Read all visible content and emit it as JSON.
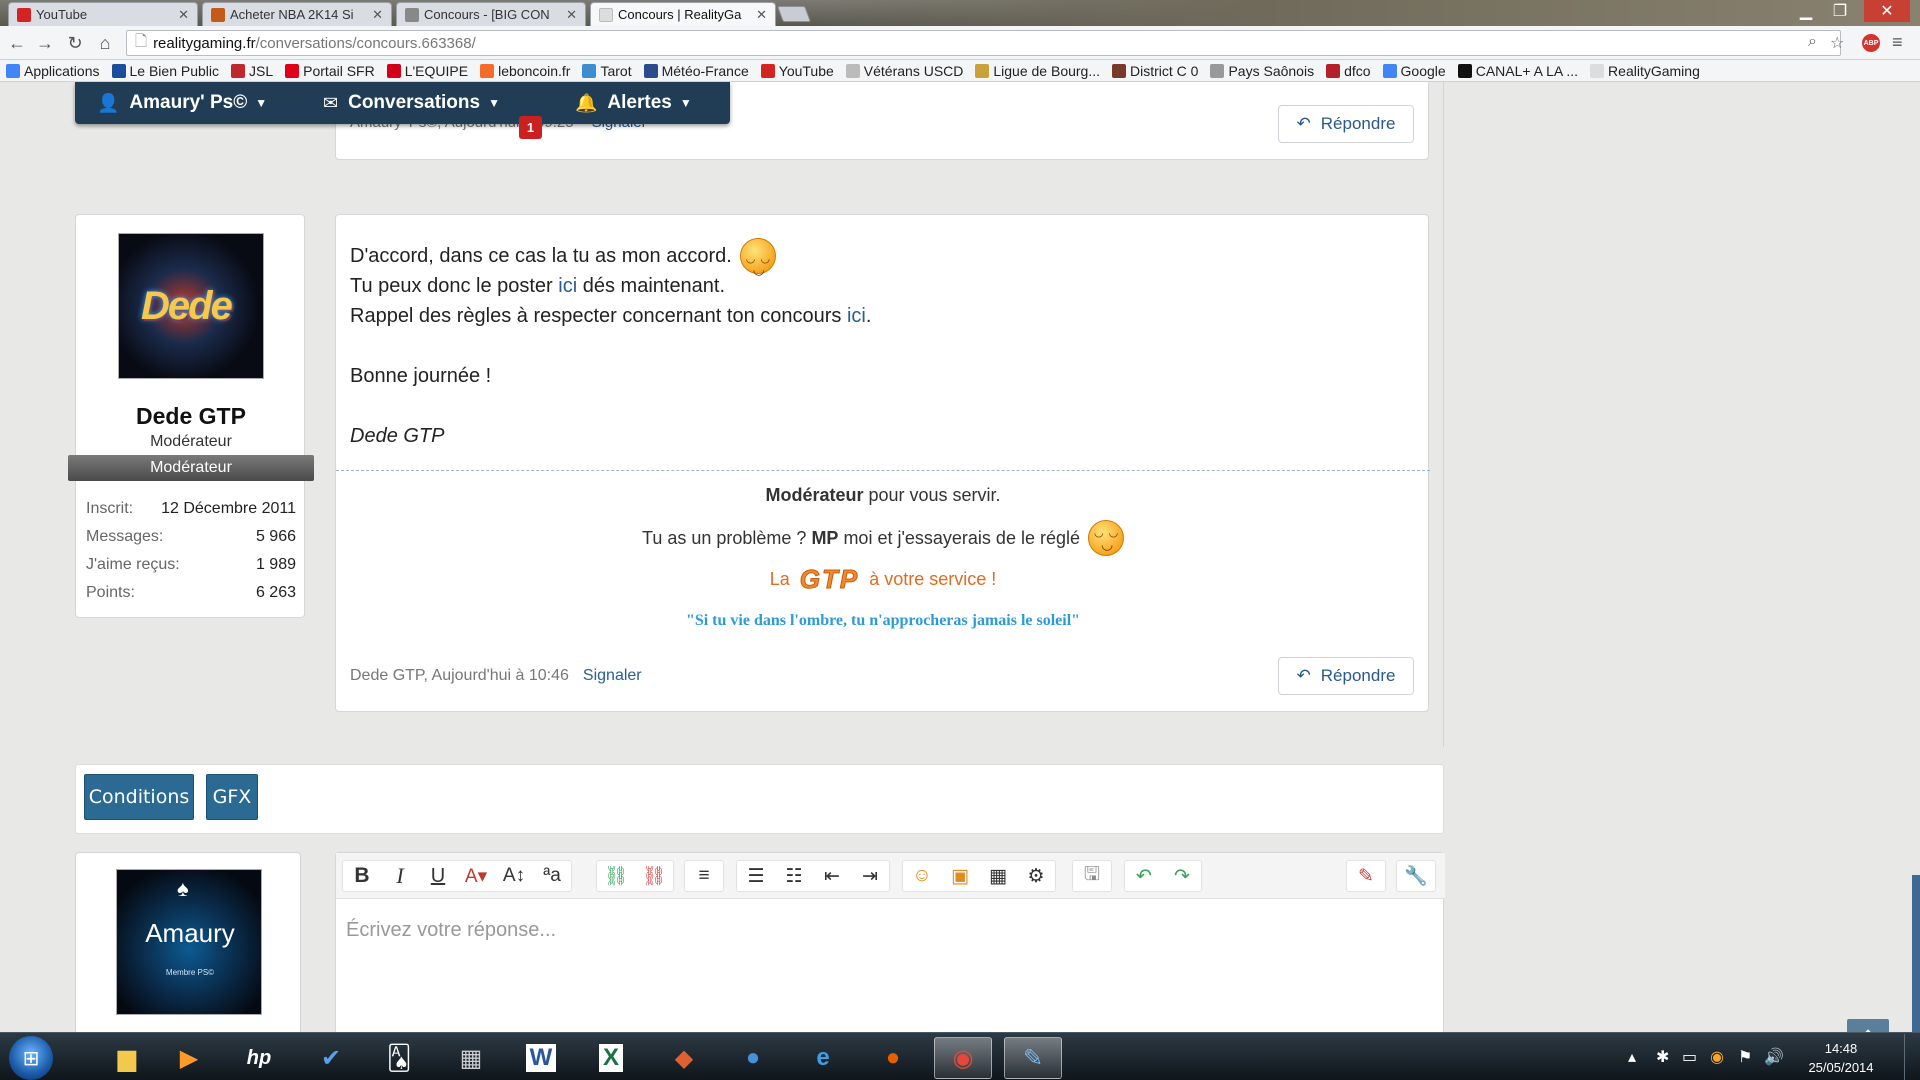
{
  "browser": {
    "tabs": [
      {
        "title": "YouTube",
        "favicon_color": "#d32323",
        "active": false
      },
      {
        "title": "Acheter NBA 2K14 Si",
        "favicon_color": "#c35a1a",
        "active": false
      },
      {
        "title": "Concours - [BIG CON",
        "favicon_color": "#888888",
        "active": false
      },
      {
        "title": "Concours | RealityGa",
        "favicon_color": "#dddddd",
        "active": true
      }
    ],
    "address": {
      "host": "realitygaming.fr",
      "path": "/conversations/concours.663368/"
    },
    "abp_label": "ABP",
    "bookmarks": [
      {
        "label": "Applications",
        "color": "#4285f4"
      },
      {
        "label": "Le Bien Public",
        "color": "#1a4d9c"
      },
      {
        "label": "JSL",
        "color": "#c0282b"
      },
      {
        "label": "Portail SFR",
        "color": "#e0001a"
      },
      {
        "label": "L'EQUIPE",
        "color": "#d3001a"
      },
      {
        "label": "leboncoin.fr",
        "color": "#f56b2a"
      },
      {
        "label": "Tarot",
        "color": "#3b8fd1"
      },
      {
        "label": "Météo-France",
        "color": "#2b4c8a"
      },
      {
        "label": "YouTube",
        "color": "#d32323"
      },
      {
        "label": "Vétérans USCD",
        "color": "#bbbbbb"
      },
      {
        "label": "Ligue de Bourg...",
        "color": "#c9a23a"
      },
      {
        "label": "District C 0",
        "color": "#7a3a2a"
      },
      {
        "label": "Pays Saônois",
        "color": "#999999"
      },
      {
        "label": "dfco",
        "color": "#b3202a"
      },
      {
        "label": "Google",
        "color": "#4285f4"
      },
      {
        "label": "CANAL+ A LA ...",
        "color": "#111111"
      },
      {
        "label": "RealityGaming",
        "color": "#dddddd"
      }
    ]
  },
  "navbar": {
    "account": "Amaury' Ps©",
    "conversations": "Conversations",
    "alerts": "Alertes",
    "badge_count": "1"
  },
  "prev_message": {
    "meta_text": "Amaury' Ps©, Aujourd'hui à 09:25",
    "signal": "Signaler",
    "reply": "Répondre"
  },
  "message": {
    "author": {
      "name": "Dede GTP",
      "avatar_text": "Dede",
      "title": "Modérateur",
      "banner": "Modérateur",
      "stats": [
        {
          "key": "Inscrit:",
          "value": "12 Décembre 2011"
        },
        {
          "key": "Messages:",
          "value": "5 966"
        },
        {
          "key": "J'aime reçus:",
          "value": "1 989"
        },
        {
          "key": "Points:",
          "value": "6 263"
        }
      ]
    },
    "line1": "D'accord, dans ce cas la tu as mon accord.",
    "line2_pre": "Tu peux donc le poster ",
    "line2_link": "ici",
    "line2_post": " dés maintenant.",
    "line3_pre": "Rappel des règles à respecter concernant ton concours ",
    "line3_link": "ici",
    "line3_post": ".",
    "line4": "Bonne journée !",
    "line5": "Dede GTP",
    "signature": {
      "s1_bold": "Modérateur",
      "s1_rest": " pour vous servir.",
      "s2_pre": "Tu as un problème ? ",
      "s2_bold": "MP",
      "s2_post": " moi et j'essayerais de le réglé",
      "s3_pre": "La",
      "s3_logo": "GTP",
      "s3_post": "à votre service !",
      "quote": "\"Si tu vie dans l'ombre, tu n'approcheras jamais le soleil\""
    },
    "meta_author": "Dede GTP, Aujourd'hui à 10:46",
    "signal": "Signaler",
    "reply": "Répondre"
  },
  "tags": {
    "conditions": "Conditions",
    "gfx": "GFX"
  },
  "my_avatar": {
    "name": "Amaury",
    "sub": "Membre PS©"
  },
  "editor": {
    "placeholder": "Écrivez votre réponse..."
  },
  "clock": {
    "time": "14:48",
    "date": "25/05/2014"
  }
}
